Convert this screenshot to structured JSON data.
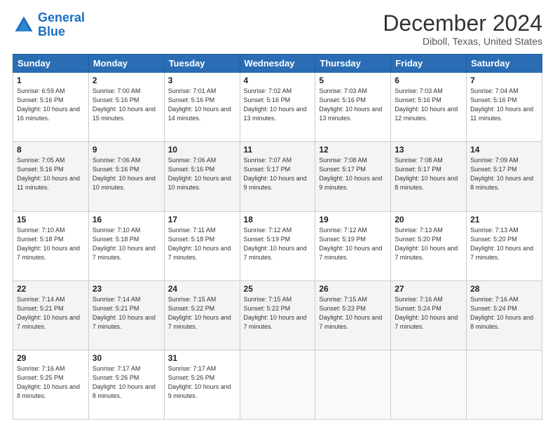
{
  "header": {
    "logo_line1": "General",
    "logo_line2": "Blue",
    "month_title": "December 2024",
    "location": "Diboll, Texas, United States"
  },
  "days_of_week": [
    "Sunday",
    "Monday",
    "Tuesday",
    "Wednesday",
    "Thursday",
    "Friday",
    "Saturday"
  ],
  "weeks": [
    [
      {
        "num": "1",
        "sunrise": "6:59 AM",
        "sunset": "5:16 PM",
        "daylight": "10 hours and 16 minutes."
      },
      {
        "num": "2",
        "sunrise": "7:00 AM",
        "sunset": "5:16 PM",
        "daylight": "10 hours and 15 minutes."
      },
      {
        "num": "3",
        "sunrise": "7:01 AM",
        "sunset": "5:16 PM",
        "daylight": "10 hours and 14 minutes."
      },
      {
        "num": "4",
        "sunrise": "7:02 AM",
        "sunset": "5:16 PM",
        "daylight": "10 hours and 13 minutes."
      },
      {
        "num": "5",
        "sunrise": "7:03 AM",
        "sunset": "5:16 PM",
        "daylight": "10 hours and 13 minutes."
      },
      {
        "num": "6",
        "sunrise": "7:03 AM",
        "sunset": "5:16 PM",
        "daylight": "10 hours and 12 minutes."
      },
      {
        "num": "7",
        "sunrise": "7:04 AM",
        "sunset": "5:16 PM",
        "daylight": "10 hours and 11 minutes."
      }
    ],
    [
      {
        "num": "8",
        "sunrise": "7:05 AM",
        "sunset": "5:16 PM",
        "daylight": "10 hours and 11 minutes."
      },
      {
        "num": "9",
        "sunrise": "7:06 AM",
        "sunset": "5:16 PM",
        "daylight": "10 hours and 10 minutes."
      },
      {
        "num": "10",
        "sunrise": "7:06 AM",
        "sunset": "5:16 PM",
        "daylight": "10 hours and 10 minutes."
      },
      {
        "num": "11",
        "sunrise": "7:07 AM",
        "sunset": "5:17 PM",
        "daylight": "10 hours and 9 minutes."
      },
      {
        "num": "12",
        "sunrise": "7:08 AM",
        "sunset": "5:17 PM",
        "daylight": "10 hours and 9 minutes."
      },
      {
        "num": "13",
        "sunrise": "7:08 AM",
        "sunset": "5:17 PM",
        "daylight": "10 hours and 8 minutes."
      },
      {
        "num": "14",
        "sunrise": "7:09 AM",
        "sunset": "5:17 PM",
        "daylight": "10 hours and 8 minutes."
      }
    ],
    [
      {
        "num": "15",
        "sunrise": "7:10 AM",
        "sunset": "5:18 PM",
        "daylight": "10 hours and 7 minutes."
      },
      {
        "num": "16",
        "sunrise": "7:10 AM",
        "sunset": "5:18 PM",
        "daylight": "10 hours and 7 minutes."
      },
      {
        "num": "17",
        "sunrise": "7:11 AM",
        "sunset": "5:18 PM",
        "daylight": "10 hours and 7 minutes."
      },
      {
        "num": "18",
        "sunrise": "7:12 AM",
        "sunset": "5:19 PM",
        "daylight": "10 hours and 7 minutes."
      },
      {
        "num": "19",
        "sunrise": "7:12 AM",
        "sunset": "5:19 PM",
        "daylight": "10 hours and 7 minutes."
      },
      {
        "num": "20",
        "sunrise": "7:13 AM",
        "sunset": "5:20 PM",
        "daylight": "10 hours and 7 minutes."
      },
      {
        "num": "21",
        "sunrise": "7:13 AM",
        "sunset": "5:20 PM",
        "daylight": "10 hours and 7 minutes."
      }
    ],
    [
      {
        "num": "22",
        "sunrise": "7:14 AM",
        "sunset": "5:21 PM",
        "daylight": "10 hours and 7 minutes."
      },
      {
        "num": "23",
        "sunrise": "7:14 AM",
        "sunset": "5:21 PM",
        "daylight": "10 hours and 7 minutes."
      },
      {
        "num": "24",
        "sunrise": "7:15 AM",
        "sunset": "5:22 PM",
        "daylight": "10 hours and 7 minutes."
      },
      {
        "num": "25",
        "sunrise": "7:15 AM",
        "sunset": "5:22 PM",
        "daylight": "10 hours and 7 minutes."
      },
      {
        "num": "26",
        "sunrise": "7:15 AM",
        "sunset": "5:23 PM",
        "daylight": "10 hours and 7 minutes."
      },
      {
        "num": "27",
        "sunrise": "7:16 AM",
        "sunset": "5:24 PM",
        "daylight": "10 hours and 7 minutes."
      },
      {
        "num": "28",
        "sunrise": "7:16 AM",
        "sunset": "5:24 PM",
        "daylight": "10 hours and 8 minutes."
      }
    ],
    [
      {
        "num": "29",
        "sunrise": "7:16 AM",
        "sunset": "5:25 PM",
        "daylight": "10 hours and 8 minutes."
      },
      {
        "num": "30",
        "sunrise": "7:17 AM",
        "sunset": "5:26 PM",
        "daylight": "10 hours and 8 minutes."
      },
      {
        "num": "31",
        "sunrise": "7:17 AM",
        "sunset": "5:26 PM",
        "daylight": "10 hours and 9 minutes."
      },
      null,
      null,
      null,
      null
    ]
  ]
}
